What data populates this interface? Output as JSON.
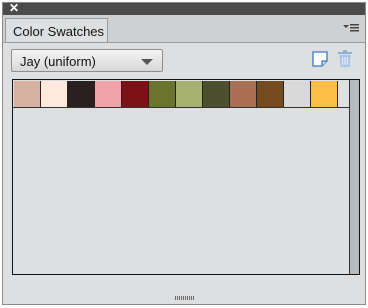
{
  "panel": {
    "tab_label": "Color Swatches",
    "preset": {
      "selected": "Jay (uniform)"
    }
  },
  "icons": {
    "close": "close-icon",
    "menu": "panel-menu-icon",
    "dropdown": "chevron-down-icon",
    "new": "new-swatch-icon",
    "delete": "trash-icon"
  },
  "swatches": [
    "#d6b0a1",
    "#ffe9df",
    "#2b2020",
    "#f0a3a7",
    "#7e1017",
    "#6b742e",
    "#a8b270",
    "#4c502d",
    "#a87050",
    "#744a20",
    "#d9d9d9",
    "#fec044"
  ],
  "colors": {
    "accent": "#3a78c2"
  }
}
